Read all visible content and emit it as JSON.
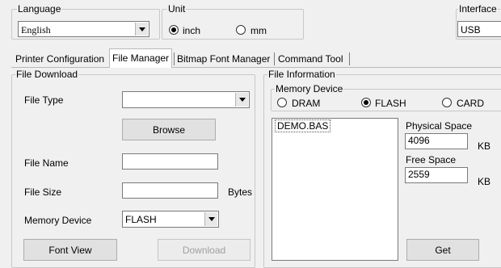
{
  "language": {
    "legend": "Language",
    "selected": "English"
  },
  "unit": {
    "legend": "Unit",
    "options": [
      "inch",
      "mm"
    ],
    "selected": "inch"
  },
  "interface": {
    "legend": "Interface",
    "selected": "USB"
  },
  "tabs": [
    {
      "label": "Printer Configuration",
      "active": false
    },
    {
      "label": "File Manager",
      "active": true
    },
    {
      "label": "Bitmap Font Manager",
      "active": false
    },
    {
      "label": "Command Tool",
      "active": false
    }
  ],
  "file_download": {
    "legend": "File Download",
    "file_type_label": "File Type",
    "file_type_value": "",
    "browse_label": "Browse",
    "file_name_label": "File Name",
    "file_name_value": "",
    "file_size_label": "File Size",
    "file_size_value": "",
    "file_size_unit": "Bytes",
    "memory_device_label": "Memory Device",
    "memory_device_value": "FLASH",
    "font_view_label": "Font View",
    "download_label": "Download"
  },
  "file_information": {
    "legend": "File Information",
    "memory_device_legend": "Memory Device",
    "memory_options": [
      "DRAM",
      "FLASH",
      "CARD"
    ],
    "memory_selected": "FLASH",
    "files": [
      "DEMO.BAS"
    ],
    "physical_space_label": "Physical Space",
    "physical_space_value": "4096",
    "physical_space_unit": "KB",
    "free_space_label": "Free Space",
    "free_space_value": "2559",
    "free_space_unit": "KB",
    "get_label": "Get"
  }
}
